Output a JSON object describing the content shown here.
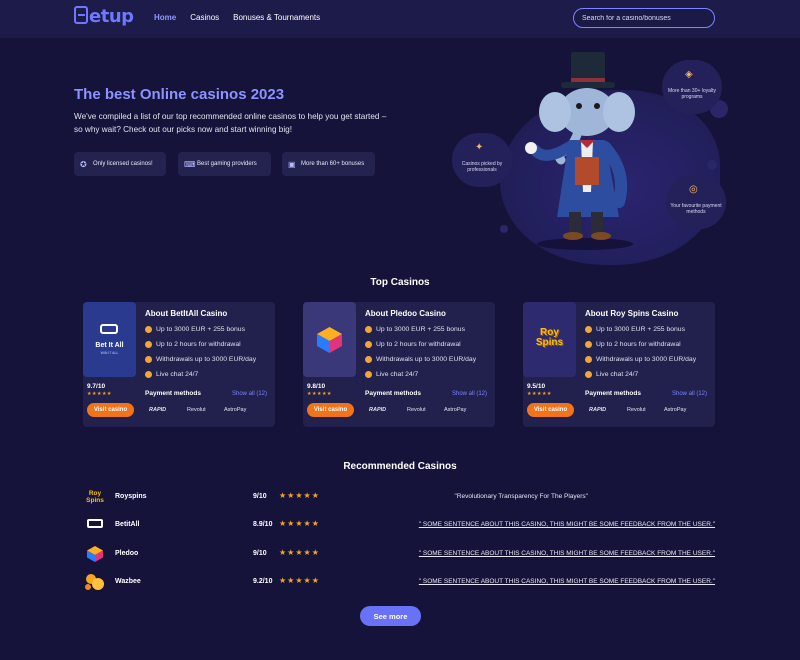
{
  "header": {
    "logo": "etup",
    "nav": [
      {
        "label": "Home"
      },
      {
        "label": "Casinos"
      },
      {
        "label": "Bonuses & Tournaments"
      }
    ],
    "search_placeholder": "Search for a casino/bonuses"
  },
  "hero": {
    "title": "The best Online casinos 2023",
    "subtitle": "We've compiled a list of our top recommended online casinos to help you get started – so why wait? Check out our picks now and start winning big!",
    "pills": [
      {
        "label": "Only licensed casinos!",
        "icon": "award-icon"
      },
      {
        "label": "Best gaming providers",
        "icon": "gamepad-icon"
      },
      {
        "label": "More than 60+ bonuses",
        "icon": "gift-icon"
      }
    ],
    "badges": [
      {
        "label": "More than 30+ loyalty programs",
        "icon": "tag-icon"
      },
      {
        "label": "Casinos picked by professionals",
        "icon": "sparkle-icon"
      },
      {
        "label": "Your favourite payment methods",
        "icon": "coins-icon"
      }
    ]
  },
  "top_casinos": {
    "title": "Top Casinos",
    "cards": [
      {
        "name": "About BetItAll Casino",
        "logo_text": "Bet It All",
        "logo_sub": "WIN IT ALL",
        "features": [
          "Up to 3000 EUR + 255 bonus",
          "Up to 2 hours for withdrawal",
          "Withdrawals up to 3000 EUR/day",
          "Live chat 24/7"
        ],
        "rating": "9.7/10",
        "stars": "★★★★★",
        "visit": "Visit casino",
        "payment_label": "Payment methods",
        "show_all": "Show all (12)",
        "payments": [
          "RAPID",
          "Revolut",
          "AstroPay"
        ]
      },
      {
        "name": "About Pledoo Casino",
        "logo_text": "",
        "features": [
          "Up to 3000 EUR + 255 bonus",
          "Up to 2 hours for withdrawal",
          "Withdrawals up to 3000 EUR/day",
          "Live chat 24/7"
        ],
        "rating": "9.8/10",
        "stars": "★★★★★",
        "visit": "Visit casino",
        "payment_label": "Payment methods",
        "show_all": "Show all (12)",
        "payments": [
          "RAPID",
          "Revolut",
          "AstroPay"
        ]
      },
      {
        "name": "About Roy Spins Casino",
        "logo_text": "Roy Spins",
        "features": [
          "Up to 3000 EUR + 255 bonus",
          "Up to 2 hours for withdrawal",
          "Withdrawals up to 3000 EUR/day",
          "Live chat 24/7"
        ],
        "rating": "9.5/10",
        "stars": "★★★★★",
        "visit": "Visit casino",
        "payment_label": "Payment methods",
        "show_all": "Show all (12)",
        "payments": [
          "RAPID",
          "Revolut",
          "AstroPay"
        ]
      }
    ]
  },
  "recommended": {
    "title": "Recommended Casinos",
    "rows": [
      {
        "name": "Royspins",
        "score": "9/10",
        "stars": "★★★★★",
        "comment": "\"Revolutionary Transparency For The Players\"",
        "logo_text": "Roy Spins"
      },
      {
        "name": "BetitAll",
        "score": "8.9/10",
        "stars": "★★★★★",
        "comment": "\" SOME SENTENCE ABOUT THIS CASINO, THIS MIGHT BE SOME FEEDBACK FROM THE USER.\""
      },
      {
        "name": "Pledoo",
        "score": "9/10",
        "stars": "★★★★★",
        "comment": "\" SOME SENTENCE ABOUT THIS CASINO, THIS MIGHT BE SOME FEEDBACK FROM THE USER.\""
      },
      {
        "name": "Wazbee",
        "score": "9.2/10",
        "stars": "★★★★★",
        "comment": "\" SOME SENTENCE ABOUT THIS CASINO, THIS MIGHT BE SOME FEEDBACK FROM THE USER.\""
      }
    ],
    "see_more": "See more"
  }
}
